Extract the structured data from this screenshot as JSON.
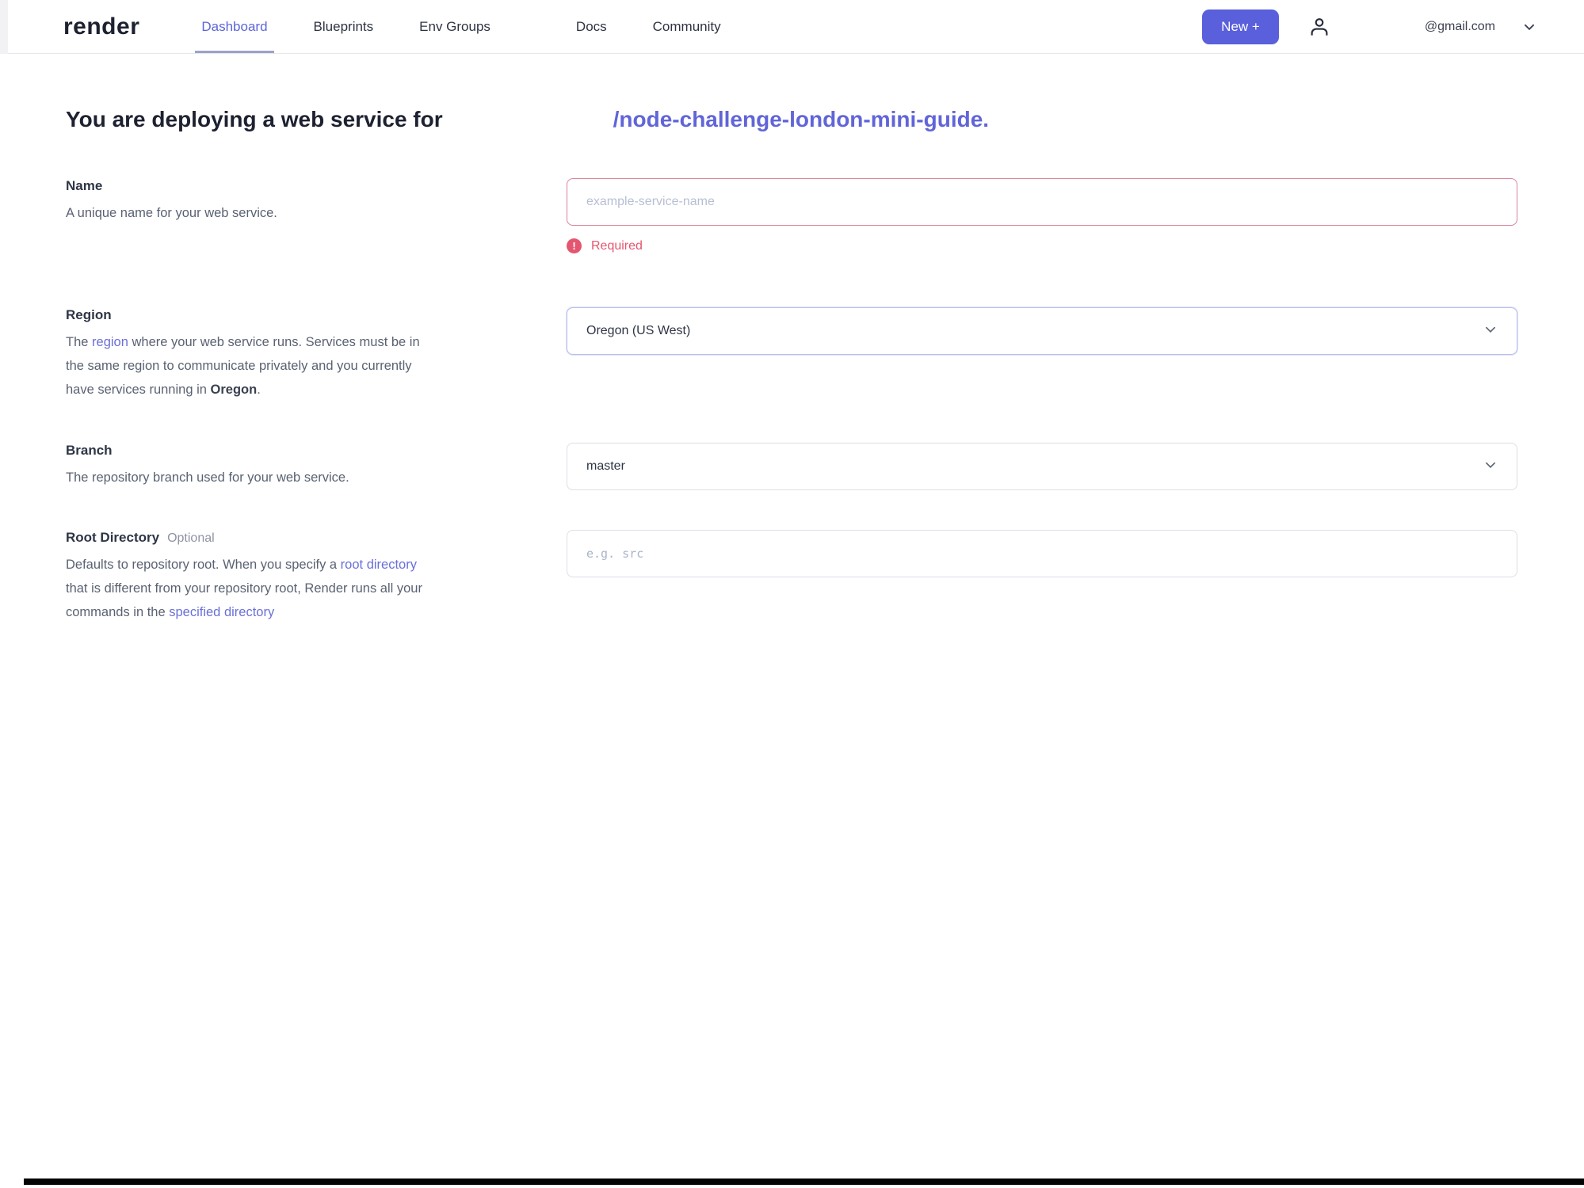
{
  "nav": {
    "logo": "render",
    "items": [
      {
        "label": "Dashboard",
        "active": true
      },
      {
        "label": "Blueprints",
        "active": false
      },
      {
        "label": "Env Groups",
        "active": false
      },
      {
        "label": "Docs",
        "active": false
      },
      {
        "label": "Community",
        "active": false
      }
    ],
    "new_button_label": "New +",
    "account_email": "@gmail.com"
  },
  "heading": {
    "prefix": "You are deploying a web service for",
    "repo": "/node-challenge-london-mini-guide."
  },
  "form": {
    "name": {
      "label": "Name",
      "description": "A unique name for your web service.",
      "placeholder": "example-service-name",
      "value": "",
      "error": "Required",
      "error_icon_glyph": "!"
    },
    "region": {
      "label": "Region",
      "desc_pre": "The ",
      "desc_link": "region",
      "desc_mid": " where your web service runs. Services must be in the same region to communicate privately and you currently have services running in ",
      "desc_bold": "Oregon",
      "desc_end": ".",
      "value": "Oregon (US West)"
    },
    "branch": {
      "label": "Branch",
      "description": "The repository branch used for your web service.",
      "value": "master"
    },
    "root_directory": {
      "label": "Root Directory",
      "optional_tag": "Optional",
      "desc_line1": "Defaults to repository root. When you specify a ",
      "desc_link1": "root directory",
      "desc_line2_rest": " that is different from your repository root, Render runs all your commands in the ",
      "desc_link2": "specified directory",
      "placeholder": "e.g. src",
      "value": ""
    }
  },
  "colors": {
    "accent_purple": "#5a5fdb",
    "heading_repo_purple": "#6165d8",
    "error_pink": "#e4566f",
    "error_border": "#d8849a",
    "region_focus_border": "#b9c0ee",
    "input_border": "#dcdfe6",
    "text_dark": "#1d2130",
    "text_gray": "#5a6272"
  }
}
